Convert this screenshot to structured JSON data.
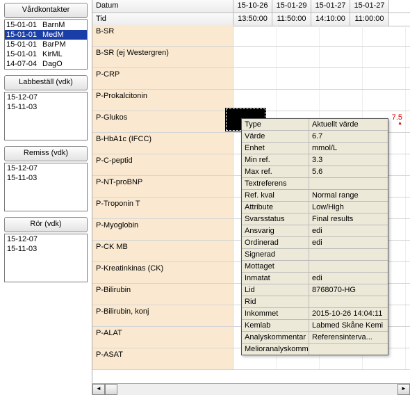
{
  "left": {
    "panels": [
      {
        "label": "Vårdkontakter",
        "rows": [
          {
            "d": "15-01-01",
            "t": "BarnM"
          },
          {
            "d": "15-01-01",
            "t": "MedM",
            "sel": true
          },
          {
            "d": "15-01-01",
            "t": "BarPM"
          },
          {
            "d": "15-01-01",
            "t": "KirML"
          },
          {
            "d": "14-07-04",
            "t": "DagO"
          }
        ]
      },
      {
        "label": "Labbeställ (vdk)",
        "dates": [
          "15-12-07",
          "15-11-03"
        ]
      },
      {
        "label": "Remiss (vdk)",
        "dates": [
          "15-12-07",
          "15-11-03"
        ]
      },
      {
        "label": "Rör (vdk)",
        "dates": [
          "15-12-07",
          "15-11-03"
        ]
      }
    ]
  },
  "grid": {
    "header_rows": [
      {
        "label": "Datum",
        "cells": [
          "15-10-26",
          "15-01-29",
          "15-01-27",
          "15-01-27"
        ]
      },
      {
        "label": "Tid",
        "cells": [
          "13:50:00",
          "11:50:00",
          "14:10:00",
          "11:00:00"
        ]
      }
    ],
    "rows": [
      {
        "label": "B-SR",
        "cells": [
          "",
          "",
          "",
          ""
        ]
      },
      {
        "label": "B-SR (ej Westergren)",
        "cells": [
          "",
          "",
          "",
          ""
        ]
      },
      {
        "label": "P-CRP",
        "cells": [
          "",
          "",
          "",
          ""
        ]
      },
      {
        "label": "P-Prokalcitonin",
        "cells": [
          "",
          "",
          "",
          ""
        ]
      },
      {
        "label": "P-Glukos",
        "cells": [
          "",
          "",
          "",
          "7.5"
        ],
        "red_last": true,
        "focused_col": 0
      },
      {
        "label": "B-HbA1c (IFCC)",
        "cells": [
          "",
          "",
          "",
          ""
        ]
      },
      {
        "label": "P-C-peptid",
        "cells": [
          "",
          "",
          "",
          ""
        ]
      },
      {
        "label": "P-NT-proBNP",
        "cells": [
          "",
          "",
          "",
          ""
        ]
      },
      {
        "label": "P-Troponin T",
        "cells": [
          "",
          "",
          "",
          ""
        ]
      },
      {
        "label": "P-Myoglobin",
        "cells": [
          "",
          "",
          "",
          ""
        ]
      },
      {
        "label": "P-CK MB",
        "cells": [
          "",
          "",
          "",
          ""
        ]
      },
      {
        "label": "P-Kreatinkinas (CK)",
        "cells": [
          "",
          "",
          "",
          ""
        ]
      },
      {
        "label": "P-Bilirubin",
        "cells": [
          "",
          "",
          "",
          ""
        ]
      },
      {
        "label": "P-Bilirubin, konj",
        "cells": [
          "",
          "",
          "",
          ""
        ]
      },
      {
        "label": "P-ALAT",
        "cells": [
          "",
          "",
          "",
          ""
        ]
      },
      {
        "label": "P-ASAT",
        "cells": [
          "",
          "",
          "",
          ""
        ]
      }
    ]
  },
  "detail": [
    {
      "k": "Type",
      "v": "Aktuellt värde"
    },
    {
      "k": "Värde",
      "v": "6.7"
    },
    {
      "k": "Enhet",
      "v": "mmol/L"
    },
    {
      "k": "Min ref.",
      "v": "3.3"
    },
    {
      "k": "Max ref.",
      "v": "5.6"
    },
    {
      "k": "Textreferens",
      "v": ""
    },
    {
      "k": "Ref. kval",
      "v": "Normal range"
    },
    {
      "k": "Attribute",
      "v": "Low/High"
    },
    {
      "k": "Svarsstatus",
      "v": "Final results"
    },
    {
      "k": "Ansvarig",
      "v": "edi"
    },
    {
      "k": "Ordinerad",
      "v": "edi"
    },
    {
      "k": "Signerad",
      "v": ""
    },
    {
      "k": "Mottaget",
      "v": ""
    },
    {
      "k": "Inmatat",
      "v": "edi"
    },
    {
      "k": "Lid",
      "v": "8768070-HG"
    },
    {
      "k": "Rid",
      "v": ""
    },
    {
      "k": "Inkommet",
      "v": "2015-10-26 14:04:11"
    },
    {
      "k": "Kemlab",
      "v": "Labmed Skåne Kemi"
    },
    {
      "k": "Analyskommentar",
      "v": "Referensinterva..."
    },
    {
      "k": "Melioranalyskomm",
      "v": ""
    }
  ],
  "scroll": {
    "left": "◄",
    "right": "►"
  }
}
